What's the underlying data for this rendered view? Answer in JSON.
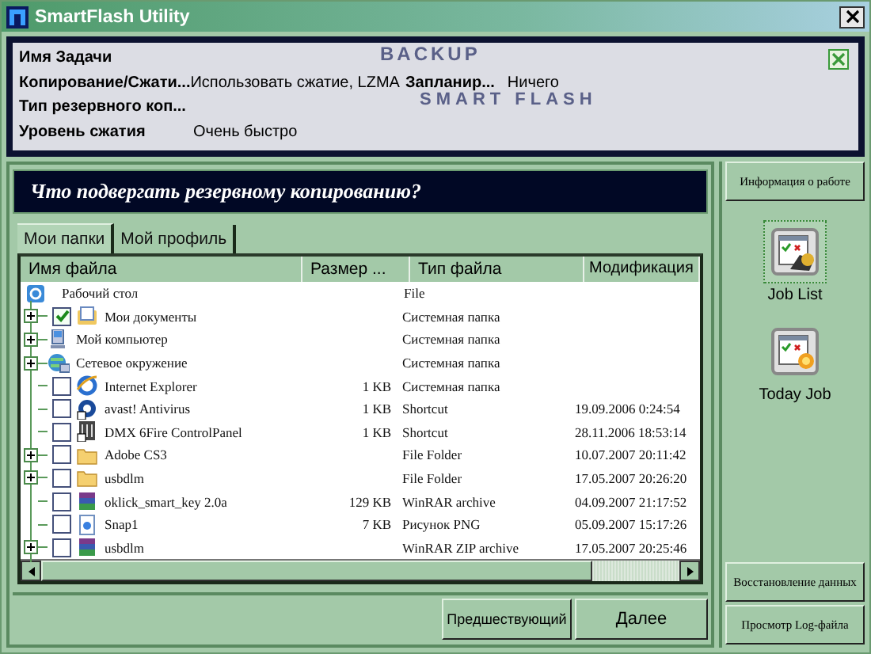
{
  "window": {
    "title": "SmartFlash Utility"
  },
  "summary": {
    "logo_top": "BACKUP",
    "logo_bottom": "SMART FLASH",
    "rows": [
      {
        "label": "Имя Задачи",
        "value": ""
      },
      {
        "label": "Копирование/Сжати...",
        "value": "Использовать сжатие, LZMA",
        "label2": "Запланир...",
        "value2": "Ничего"
      },
      {
        "label": "Тип резервного коп...",
        "value": ""
      },
      {
        "label": "Уровень сжатия",
        "value": "Очень быстро"
      }
    ]
  },
  "banner": "Что подвергать резервному копированию?",
  "tabs": [
    {
      "label": "Мои папки",
      "selected": true
    },
    {
      "label": "Мой профиль",
      "selected": false
    }
  ],
  "table": {
    "columns": [
      "Имя файла",
      "Размер ...",
      "Тип файла",
      "Модификация"
    ],
    "root": {
      "name": "Рабочий стол",
      "type": "File",
      "kind": "desktop",
      "children": [
        {
          "name": "Мои документы",
          "type": "Системная папка",
          "kind": "documents",
          "expandable": true,
          "checkable": true,
          "checked": true
        },
        {
          "name": "Мой компьютер",
          "type": "Системная папка",
          "kind": "computer",
          "expandable": true,
          "checkable": false
        },
        {
          "name": "Сетевое окружение",
          "type": "Системная папка",
          "kind": "network",
          "expandable": true,
          "checkable": false
        },
        {
          "name": "Internet Explorer",
          "size": "1 KB",
          "type": "Системная папка",
          "kind": "browser",
          "expandable": false,
          "checkable": true,
          "checked": false
        },
        {
          "name": "avast! Antivirus",
          "size": "1 KB",
          "type": "Shortcut",
          "modified": "19.09.2006 0:24:54",
          "kind": "antivirus",
          "expandable": false,
          "checkable": true,
          "checked": false
        },
        {
          "name": "DMX 6Fire ControlPanel",
          "size": "1 KB",
          "type": "Shortcut",
          "modified": "28.11.2006 18:53:14",
          "kind": "mixer",
          "expandable": false,
          "checkable": true,
          "checked": false
        },
        {
          "name": "Adobe CS3",
          "type": "File Folder",
          "modified": "10.07.2007 20:11:42",
          "kind": "folder",
          "expandable": true,
          "checkable": true,
          "checked": false
        },
        {
          "name": "usbdlm",
          "type": "File Folder",
          "modified": "17.05.2007 20:26:20",
          "kind": "folder",
          "expandable": true,
          "checkable": true,
          "checked": false
        },
        {
          "name": "oklick_smart_key 2.0a",
          "size": "129 KB",
          "type": "WinRAR archive",
          "modified": "04.09.2007 21:17:52",
          "kind": "archive",
          "expandable": false,
          "checkable": true,
          "checked": false
        },
        {
          "name": "Snap1",
          "size": "7 KB",
          "type": "Рисунок PNG",
          "modified": "05.09.2007 15:17:26",
          "kind": "image",
          "expandable": false,
          "checkable": true,
          "checked": false
        },
        {
          "name": "usbdlm",
          "type": "WinRAR ZIP archive",
          "modified": "17.05.2007 20:25:46",
          "kind": "archive",
          "expandable": true,
          "checkable": true,
          "checked": false
        }
      ]
    }
  },
  "footer_buttons": [
    "Предшествующий",
    "Далее"
  ],
  "sidebar": {
    "top_button": "Информация о работе",
    "jobs": [
      {
        "label": "Job List",
        "kind": "list",
        "selected": true
      },
      {
        "label": "Today Job",
        "kind": "today",
        "selected": false
      }
    ],
    "bottom_buttons": [
      "Восстановление данных",
      "Просмотр Log-файла"
    ]
  }
}
